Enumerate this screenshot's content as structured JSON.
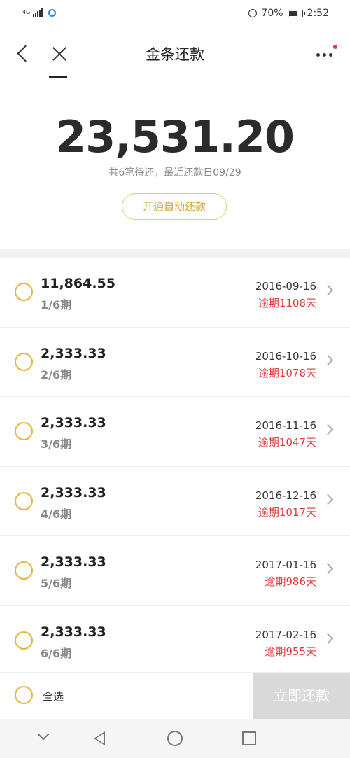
{
  "status_bar": {
    "network": "4G",
    "battery_percent": "70%",
    "battery_level": 0.7,
    "time": "2:52",
    "icons": [
      "signal-icon",
      "app-circle-icon",
      "alarm-icon",
      "battery-icon"
    ]
  },
  "nav": {
    "title": "金条还款",
    "icons": [
      "back-icon",
      "close-icon",
      "more-icon"
    ],
    "notification_dot_color": "#f03a2c"
  },
  "summary": {
    "total": "23,531.20",
    "subtitle": "共6笔待还，最近还款日09/29",
    "auto_pay_button": "开通自动还款"
  },
  "installments": [
    {
      "amount": "11,864.55",
      "period": "1/6期",
      "date": "2016-09-16",
      "overdue": "逾期1108天"
    },
    {
      "amount": "2,333.33",
      "period": "2/6期",
      "date": "2016-10-16",
      "overdue": "逾期1078天"
    },
    {
      "amount": "2,333.33",
      "period": "3/6期",
      "date": "2016-11-16",
      "overdue": "逾期1047天"
    },
    {
      "amount": "2,333.33",
      "period": "4/6期",
      "date": "2016-12-16",
      "overdue": "逾期1017天"
    },
    {
      "amount": "2,333.33",
      "period": "5/6期",
      "date": "2017-01-16",
      "overdue": "逾期986天"
    },
    {
      "amount": "2,333.33",
      "period": "6/6期",
      "date": "2017-02-16",
      "overdue": "逾期955天"
    }
  ],
  "bottom_bar": {
    "select_all_label": "全选",
    "pay_button": "立即还款"
  },
  "colors": {
    "accent_gold": "#e5b63d",
    "overdue_red": "#e5383b",
    "disabled_button": "#d9d9d9"
  }
}
